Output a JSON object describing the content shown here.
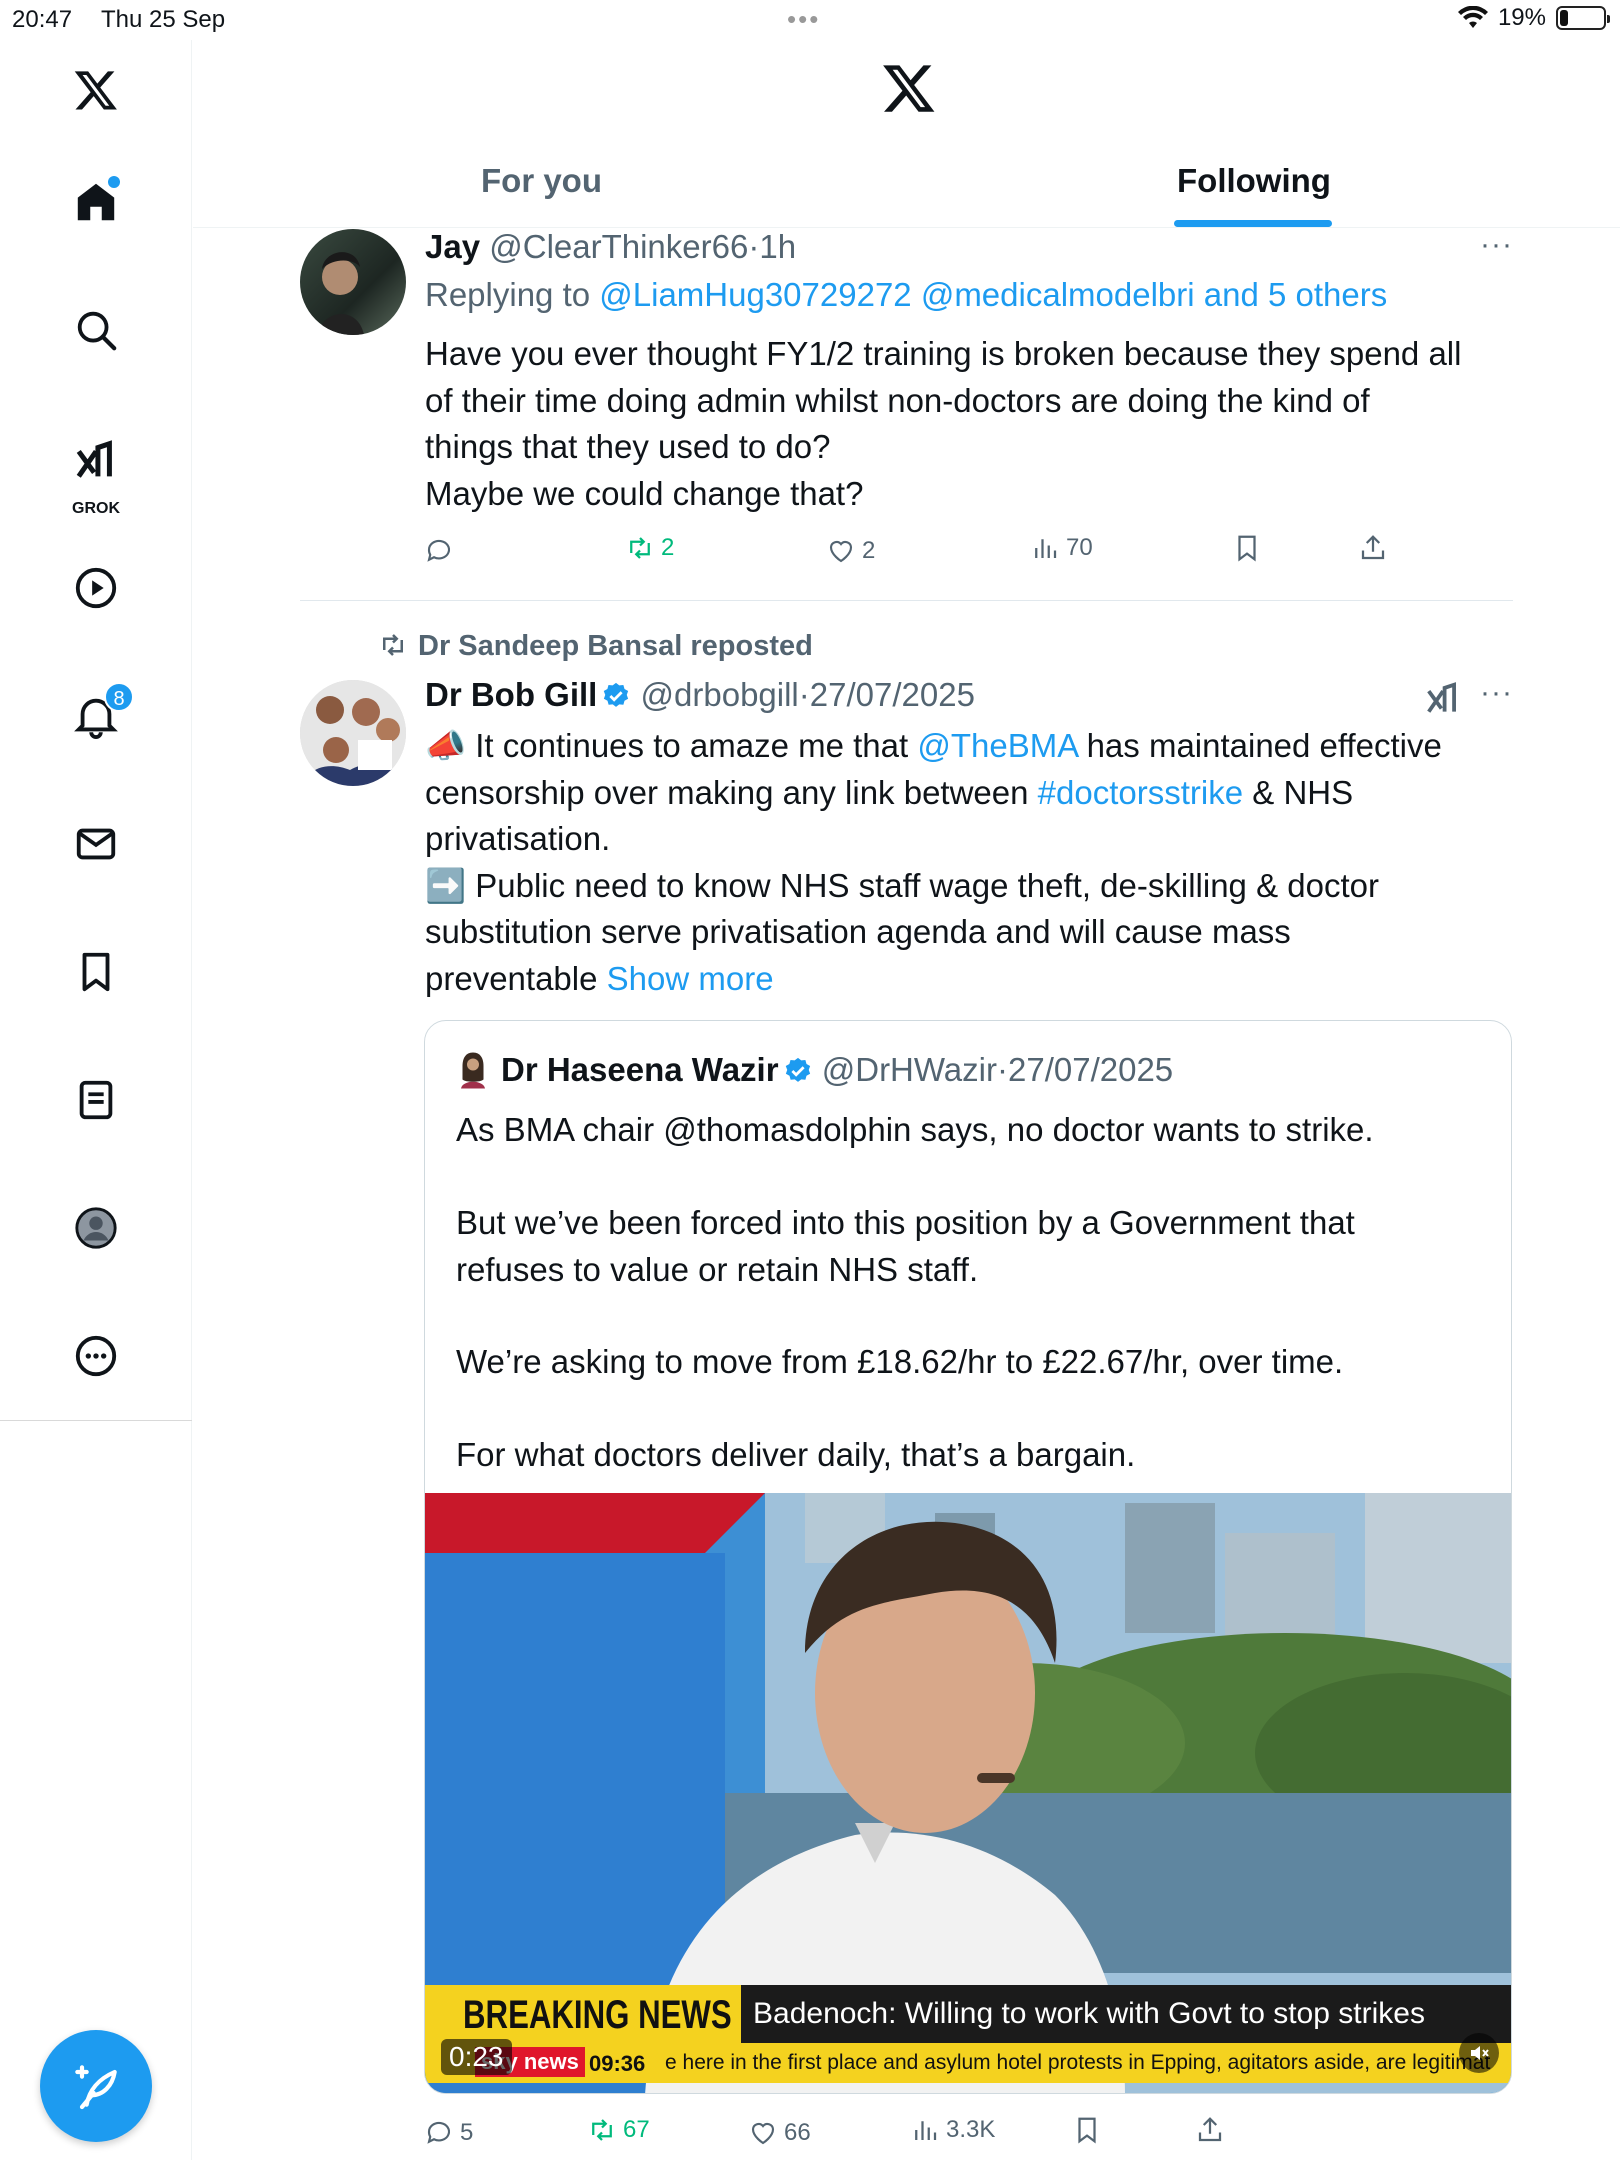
{
  "status": {
    "time": "20:47",
    "date": "Thu 25 Sep",
    "dots": "•••",
    "battery": "19%",
    "battery_level": 0.19
  },
  "sidebar": {
    "items": [
      {
        "icon": "x-logo-icon"
      },
      {
        "icon": "home-icon",
        "dot": true
      },
      {
        "icon": "search-icon"
      },
      {
        "icon": "grok-icon",
        "label": "GROK"
      },
      {
        "icon": "play-icon"
      },
      {
        "icon": "bell-icon",
        "badge": "8"
      },
      {
        "icon": "mail-icon"
      },
      {
        "icon": "bookmark-icon"
      },
      {
        "icon": "list-icon"
      },
      {
        "icon": "profile-icon"
      },
      {
        "icon": "more-icon"
      }
    ],
    "compose_icon": "compose-icon"
  },
  "header": {
    "tabs": [
      {
        "label": "For you",
        "active": false
      },
      {
        "label": "Following",
        "active": true
      }
    ]
  },
  "tweets": [
    {
      "name": "Jay",
      "handle": "@ClearThinker66",
      "sep": "·",
      "time": "1h",
      "replying_prefix": "Replying to ",
      "replying_to": "@LiamHug30729272 @medicalmodelbri and 5 others",
      "body": "Have you ever thought FY1/2 training is broken because they spend all\nof their time doing admin whilst non-doctors are doing the kind of\nthings that they used to do?\nMaybe we could change that?",
      "stats": {
        "replies": "",
        "reposts": "2",
        "likes": "2",
        "views": "70"
      }
    },
    {
      "repost_by": "Dr Sandeep Bansal reposted",
      "name": "Dr Bob Gill",
      "handle": "@drbobgill",
      "sep": "·",
      "time": "27/07/2025",
      "body_parts": {
        "l1_emoji": "📣",
        "l1_a": " It continues to amaze me that ",
        "l1_link": "@TheBMA",
        "l1_b": " has maintained effective",
        "l2_a": "censorship over making any link between ",
        "l2_link": "#doctorsstrike",
        "l2_b": " & NHS",
        "l3": "privatisation.",
        "l4_emoji": "➡️",
        "l4": " Public need to know NHS staff wage theft, de-skilling & doctor",
        "l5": "substitution serve privatisation agenda and will cause mass",
        "l6": "preventable ",
        "show_more": "Show more"
      },
      "quote": {
        "name": "Dr Haseena Wazir",
        "handle": "@DrHWazir",
        "sep": "·",
        "time": "27/07/2025",
        "p1": "As BMA chair @thomasdolphin says, no doctor wants to strike.",
        "p2": "But we’ve been forced into this position by a Government that\nrefuses to value or retain NHS staff.",
        "p3": "We’re asking to move from £18.62/hr to £22.67/hr, over time.",
        "p4": "For what doctors deliver daily, that’s a bargain.",
        "video": {
          "breaking": "BREAKING NEWS",
          "headline": "Badenoch: Willing to work with Govt to stop strikes",
          "channel": "sky news",
          "clock": "09:36",
          "ticker": "e here in the first place and asylum hotel protests in Epping, agitators aside, are legitimat",
          "duration": "0:23"
        }
      },
      "stats": {
        "replies": "5",
        "reposts": "67",
        "likes": "66",
        "views": "3.3K"
      }
    }
  ],
  "colors": {
    "accent": "#1d9bf0",
    "repost_green": "#00ba7c",
    "muted": "#536471"
  }
}
